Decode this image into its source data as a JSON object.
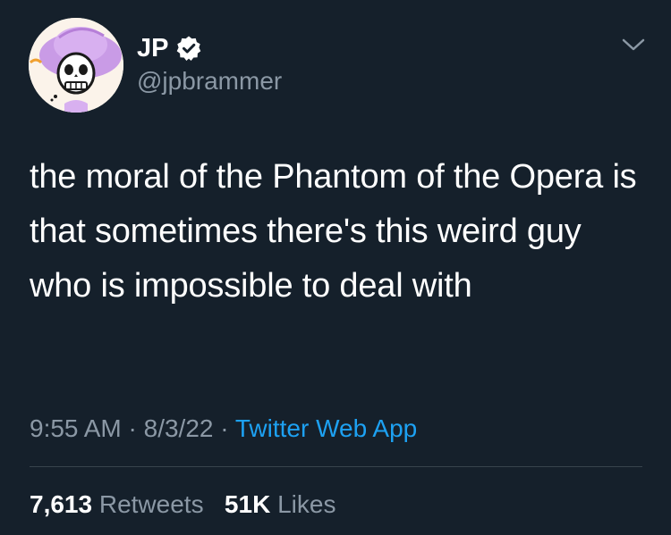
{
  "author": {
    "display_name": "JP",
    "handle": "@jpbrammer",
    "verified": true,
    "avatar": "sugar-skull-avatar"
  },
  "tweet": {
    "text": "the moral of the Phantom of the Opera is that sometimes there's this weird guy who is impossible to deal with",
    "time": "9:55 AM",
    "separator": "·",
    "date": "8/3/22",
    "source": "Twitter Web App"
  },
  "stats": {
    "retweets_count": "7,613",
    "retweets_label": "Retweets",
    "likes_count": "51K",
    "likes_label": "Likes"
  },
  "icons": {
    "verified": "verified-badge-icon",
    "menu": "chevron-down-icon"
  },
  "colors": {
    "background": "#15202b",
    "text": "#ffffff",
    "secondary": "#8b98a5",
    "link": "#1da1f2",
    "divider": "#38444d"
  }
}
